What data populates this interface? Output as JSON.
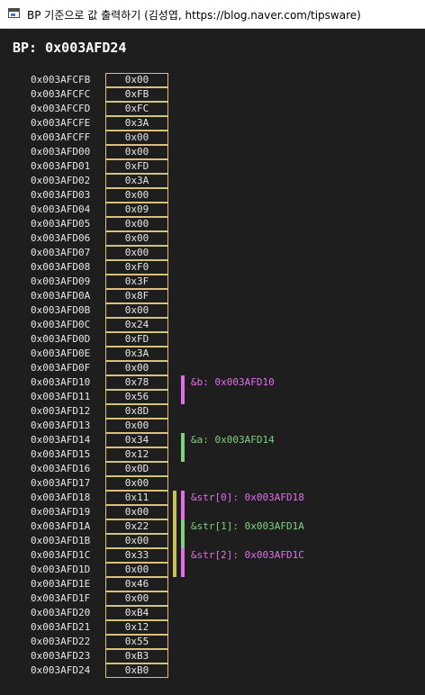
{
  "window": {
    "title": "BP 기준으로 값 출력하기 (김성엽, https://blog.naver.com/tipsware)",
    "icon": "app-window-icon"
  },
  "header": {
    "text": "BP: 0x003AFD24"
  },
  "memory": [
    {
      "address": "0x003AFCFB",
      "value": "0x00"
    },
    {
      "address": "0x003AFCFC",
      "value": "0xFB"
    },
    {
      "address": "0x003AFCFD",
      "value": "0xFC"
    },
    {
      "address": "0x003AFCFE",
      "value": "0x3A"
    },
    {
      "address": "0x003AFCFF",
      "value": "0x00"
    },
    {
      "address": "0x003AFD00",
      "value": "0x00"
    },
    {
      "address": "0x003AFD01",
      "value": "0xFD"
    },
    {
      "address": "0x003AFD02",
      "value": "0x3A"
    },
    {
      "address": "0x003AFD03",
      "value": "0x00"
    },
    {
      "address": "0x003AFD04",
      "value": "0x09"
    },
    {
      "address": "0x003AFD05",
      "value": "0x00"
    },
    {
      "address": "0x003AFD06",
      "value": "0x00"
    },
    {
      "address": "0x003AFD07",
      "value": "0x00"
    },
    {
      "address": "0x003AFD08",
      "value": "0xF0"
    },
    {
      "address": "0x003AFD09",
      "value": "0x3F"
    },
    {
      "address": "0x003AFD0A",
      "value": "0x8F"
    },
    {
      "address": "0x003AFD0B",
      "value": "0x00"
    },
    {
      "address": "0x003AFD0C",
      "value": "0x24"
    },
    {
      "address": "0x003AFD0D",
      "value": "0xFD"
    },
    {
      "address": "0x003AFD0E",
      "value": "0x3A"
    },
    {
      "address": "0x003AFD0F",
      "value": "0x00"
    },
    {
      "address": "0x003AFD10",
      "value": "0x78"
    },
    {
      "address": "0x003AFD11",
      "value": "0x56"
    },
    {
      "address": "0x003AFD12",
      "value": "0x8D"
    },
    {
      "address": "0x003AFD13",
      "value": "0x00"
    },
    {
      "address": "0x003AFD14",
      "value": "0x34"
    },
    {
      "address": "0x003AFD15",
      "value": "0x12"
    },
    {
      "address": "0x003AFD16",
      "value": "0x0D"
    },
    {
      "address": "0x003AFD17",
      "value": "0x00"
    },
    {
      "address": "0x003AFD18",
      "value": "0x11"
    },
    {
      "address": "0x003AFD19",
      "value": "0x00"
    },
    {
      "address": "0x003AFD1A",
      "value": "0x22"
    },
    {
      "address": "0x003AFD1B",
      "value": "0x00"
    },
    {
      "address": "0x003AFD1C",
      "value": "0x33"
    },
    {
      "address": "0x003AFD1D",
      "value": "0x00"
    },
    {
      "address": "0x003AFD1E",
      "value": "0x46"
    },
    {
      "address": "0x003AFD1F",
      "value": "0x00"
    },
    {
      "address": "0x003AFD20",
      "value": "0xB4"
    },
    {
      "address": "0x003AFD21",
      "value": "0x12"
    },
    {
      "address": "0x003AFD22",
      "value": "0x55"
    },
    {
      "address": "0x003AFD23",
      "value": "0xB3"
    },
    {
      "address": "0x003AFD24",
      "value": "0xB0"
    }
  ],
  "annotations": [
    {
      "label": "&b: 0x003AFD10",
      "row": 21,
      "span": 2,
      "color": "#e16ee8"
    },
    {
      "label": "&a: 0x003AFD14",
      "row": 25,
      "span": 2,
      "color": "#7fd07f"
    },
    {
      "label": "&str[0]: 0x003AFD18",
      "row": 29,
      "span": 2,
      "color": "#e16ee8"
    },
    {
      "label": "&str[1]: 0x003AFD1A",
      "row": 31,
      "span": 2,
      "color": "#7fd07f"
    },
    {
      "label": "&str[2]: 0x003AFD1C",
      "row": 33,
      "span": 2,
      "color": "#e16ee8"
    }
  ],
  "array_bracket": {
    "row": 29,
    "span": 6,
    "color": "#c8c05a"
  },
  "colors": {
    "background": "#1e1e1e",
    "cell_border": "#d8c27a",
    "text": "#e6e6e6",
    "header": "#ffffff"
  }
}
